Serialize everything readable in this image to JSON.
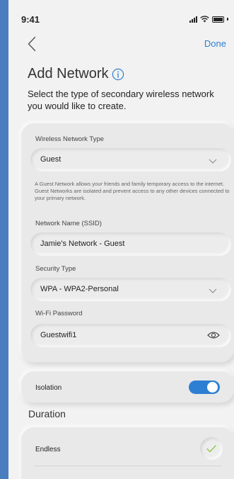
{
  "status": {
    "time": "9:41"
  },
  "nav": {
    "done_label": "Done"
  },
  "header": {
    "title": "Add Network",
    "subtitle": "Select the type of secondary wireless network you would like to create."
  },
  "form": {
    "network_type": {
      "label": "Wireless Network Type",
      "value": "Guest"
    },
    "description": "A Guest Network allows your friends and family temporary access to the internet. Guest Networks are isolated and prevent access to any other devices connected to your primary network.",
    "ssid": {
      "label": "Network Name (SSID)",
      "value": "Jamie's Network - Guest"
    },
    "security": {
      "label": "Security Type",
      "value": "WPA - WPA2-Personal"
    },
    "password": {
      "label": "Wi-Fi Password",
      "value": "Guestwifi1"
    }
  },
  "isolation": {
    "label": "Isolation",
    "enabled": true
  },
  "duration": {
    "title": "Duration",
    "options": [
      {
        "label": "Endless",
        "selected": true
      }
    ]
  },
  "colors": {
    "accent": "#2d7fd3",
    "frame": "#4a7ec0",
    "background": "#f2f2f2",
    "check": "#8cc63f"
  },
  "icons": [
    "back-chevron-icon",
    "info-icon",
    "chevron-down-icon",
    "eye-icon",
    "checkmark-icon",
    "signal-icon",
    "wifi-icon",
    "battery-icon"
  ]
}
